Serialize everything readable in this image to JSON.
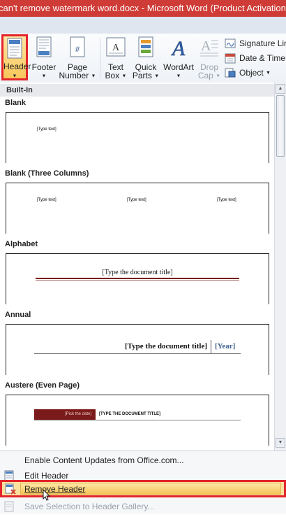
{
  "window": {
    "title": "can't remove watermark word.docx - Microsoft Word (Product Activation Failed)"
  },
  "ribbon": {
    "header": {
      "label": "Header"
    },
    "footer": {
      "label": "Footer"
    },
    "page_number": {
      "line1": "Page",
      "line2": "Number"
    },
    "text_box": {
      "line1": "Text",
      "line2": "Box"
    },
    "quick_parts": {
      "line1": "Quick",
      "line2": "Parts"
    },
    "wordart": {
      "label": "WordArt"
    },
    "drop_cap": {
      "line1": "Drop",
      "line2": "Cap"
    },
    "signature_line": {
      "label": "Signature Line"
    },
    "date_time": {
      "label": "Date & Time"
    },
    "object": {
      "label": "Object"
    }
  },
  "gallery": {
    "category": "Built-In",
    "items": [
      {
        "title": "Blank",
        "placeholders": [
          "[Type text]"
        ]
      },
      {
        "title": "Blank (Three Columns)",
        "placeholders": [
          "[Type text]",
          "[Type text]",
          "[Type text]"
        ]
      },
      {
        "title": "Alphabet",
        "placeholders": [
          "[Type the document title]"
        ]
      },
      {
        "title": "Annual",
        "placeholders": [
          "[Type the document title]",
          "[Year]"
        ]
      },
      {
        "title": "Austere (Even Page)",
        "placeholders": [
          "[Pick the date]",
          "[TYPE THE DOCUMENT TITLE]"
        ]
      }
    ]
  },
  "menu": {
    "enable_updates": "Enable Content Updates from Office.com...",
    "edit_header": "Edit Header",
    "remove_header": "Remove Header",
    "save_selection": "Save Selection to Header Gallery..."
  },
  "colors": {
    "title_bar": "#cf3b36",
    "highlight_border": "#e3242b",
    "alphabet_rule": "#7a1c1c",
    "annual_year": "#3b5e8c",
    "austere_band": "#7b1a1a"
  }
}
